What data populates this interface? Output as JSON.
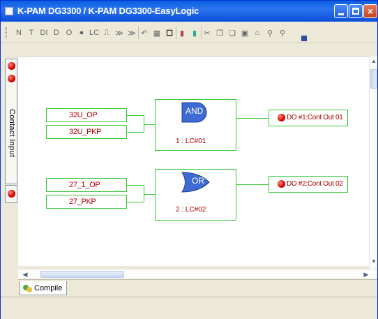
{
  "window": {
    "title": "K-PAM DG3300 / K-PAM DG3300-EasyLogic"
  },
  "toolbar": {
    "tools": [
      {
        "icon": "n-contact-icon",
        "glyph": "N"
      },
      {
        "icon": "t-timer-icon",
        "glyph": "T"
      },
      {
        "icon": "di-input-icon",
        "glyph": "DI"
      },
      {
        "icon": "do-output-icon",
        "glyph": "D"
      },
      {
        "icon": "op-icon",
        "glyph": "O"
      },
      {
        "icon": "circle-icon",
        "glyph": "●"
      },
      {
        "icon": "lc-icon",
        "glyph": "LC"
      },
      {
        "icon": "pulse-icon",
        "glyph": "⎍"
      },
      {
        "icon": "shift-right-icon",
        "glyph": "≫"
      },
      {
        "icon": "shift-right-2-icon",
        "glyph": "≫"
      },
      {
        "icon": "undo-icon",
        "glyph": "↶"
      },
      {
        "icon": "grid-icon",
        "glyph": "▦"
      },
      {
        "icon": "frame-icon",
        "glyph": "☐"
      },
      {
        "icon": "color-icon",
        "glyph": "▮"
      },
      {
        "icon": "palette-icon",
        "glyph": "▮"
      },
      {
        "icon": "cut-icon",
        "glyph": "✂"
      },
      {
        "icon": "copy-icon",
        "glyph": "❐"
      },
      {
        "icon": "paste-icon",
        "glyph": "❏"
      },
      {
        "icon": "save-icon",
        "glyph": "▣"
      },
      {
        "icon": "open-icon",
        "glyph": "⌂"
      },
      {
        "icon": "zoom-icon",
        "glyph": "⚲"
      },
      {
        "icon": "zoom-out-icon",
        "glyph": "⚲"
      }
    ]
  },
  "side_panel": {
    "tab_label": "Contact Input"
  },
  "diagram": {
    "logics": [
      {
        "inputs": [
          "32U_OP",
          "32U_PKP"
        ],
        "gate": "AND",
        "gate_label": "1 : LC#01",
        "output": "DO #1:Cont Out 01"
      },
      {
        "inputs": [
          "27_1_OP",
          "27_PKP"
        ],
        "gate": "OR",
        "gate_label": "2 : LC#02",
        "output": "DO #2:Cont Out 02"
      }
    ]
  },
  "bottom_tabs": {
    "compile": "Compile"
  },
  "colors": {
    "wire": "#38c838",
    "text": "#b00000",
    "gate_fill": "#3d6bd1",
    "titlebar": "#0a5fdf"
  }
}
